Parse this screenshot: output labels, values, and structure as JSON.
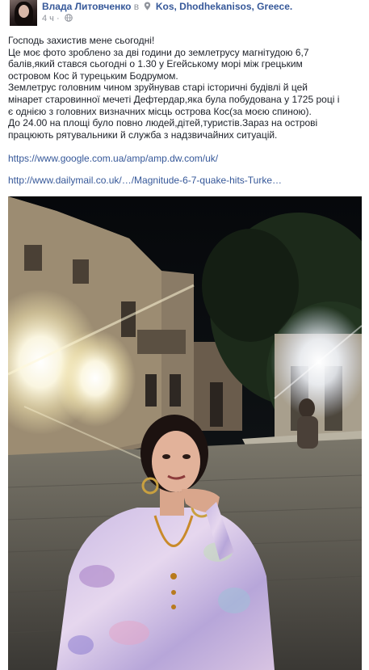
{
  "post": {
    "author": "Влада Литовченко",
    "connector": "в",
    "location": "Kos, Dhodhekanisos, Greece.",
    "time": "4 ч",
    "text_lines": [
      "Господь захистив мене сьогодні!",
      "Це моє фото зроблено за дві години до землетрусу магнітудою 6,7",
      "балів,який стався сьогодні о 1.30 у Егейському морі між грецьким",
      "островом Кос й турецьким Бодрумом.",
      "Землетрус головним чином зруйнував старі історичні будівлі й цей",
      "мінарет старовинної мечеті Дефтердар,яка була побудована у 1725 році і",
      "є однією з головних визначних місць острова Кос(за моєю спиною).",
      "До 24.00 на площі було повно людей,дітей,туристів.Зараз на острові",
      "працюють рятувальники й служба з надзвичайних ситуацій."
    ],
    "link1": "https://www.google.com.ua/amp/amp.dw.com/uk/",
    "link2": "http://www.dailymail.co.uk/…/Magnitude-6-7-quake-hits-Turke…"
  },
  "icons": {
    "location": "map-pin-icon",
    "privacy": "globe-icon"
  },
  "colors": {
    "link": "#365899",
    "meta": "#90949c",
    "text": "#1d2129"
  }
}
